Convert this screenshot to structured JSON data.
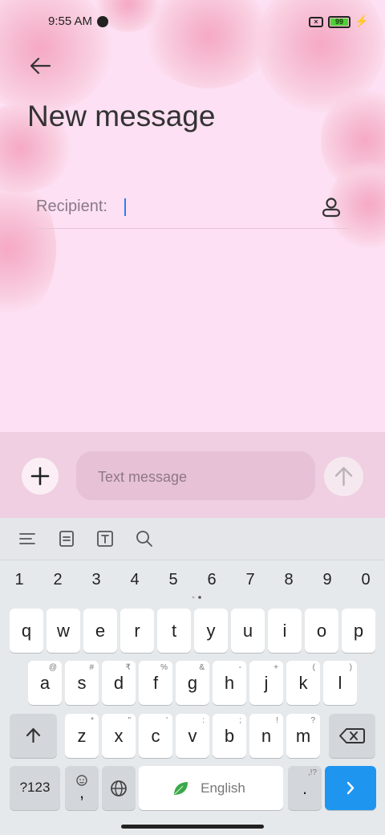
{
  "status_bar": {
    "time": "9:55 AM",
    "battery": "99"
  },
  "header": {
    "title": "New message"
  },
  "recipient": {
    "label": "Recipient:"
  },
  "compose": {
    "placeholder": "Text message"
  },
  "keyboard": {
    "numbers": [
      "1",
      "2",
      "3",
      "4",
      "5",
      "6",
      "7",
      "8",
      "9",
      "0"
    ],
    "row1": [
      {
        "k": "q",
        "h": ""
      },
      {
        "k": "w",
        "h": ""
      },
      {
        "k": "e",
        "h": ""
      },
      {
        "k": "r",
        "h": ""
      },
      {
        "k": "t",
        "h": ""
      },
      {
        "k": "y",
        "h": ""
      },
      {
        "k": "u",
        "h": ""
      },
      {
        "k": "i",
        "h": ""
      },
      {
        "k": "o",
        "h": ""
      },
      {
        "k": "p",
        "h": ""
      }
    ],
    "row2": [
      {
        "k": "a",
        "h": "@"
      },
      {
        "k": "s",
        "h": "#"
      },
      {
        "k": "d",
        "h": "₹"
      },
      {
        "k": "f",
        "h": "%"
      },
      {
        "k": "g",
        "h": "&"
      },
      {
        "k": "h",
        "h": "-"
      },
      {
        "k": "j",
        "h": "+"
      },
      {
        "k": "k",
        "h": "("
      },
      {
        "k": "l",
        "h": ")"
      }
    ],
    "row3": [
      {
        "k": "z",
        "h": "*"
      },
      {
        "k": "x",
        "h": "\""
      },
      {
        "k": "c",
        "h": "'"
      },
      {
        "k": "v",
        "h": ":"
      },
      {
        "k": "b",
        "h": ";"
      },
      {
        "k": "n",
        "h": "!"
      },
      {
        "k": "m",
        "h": "?"
      }
    ],
    "symbols_label": "?123",
    "comma_label": ",",
    "space_label": "English",
    "period_label": ".",
    "period_hint": ",!?"
  }
}
